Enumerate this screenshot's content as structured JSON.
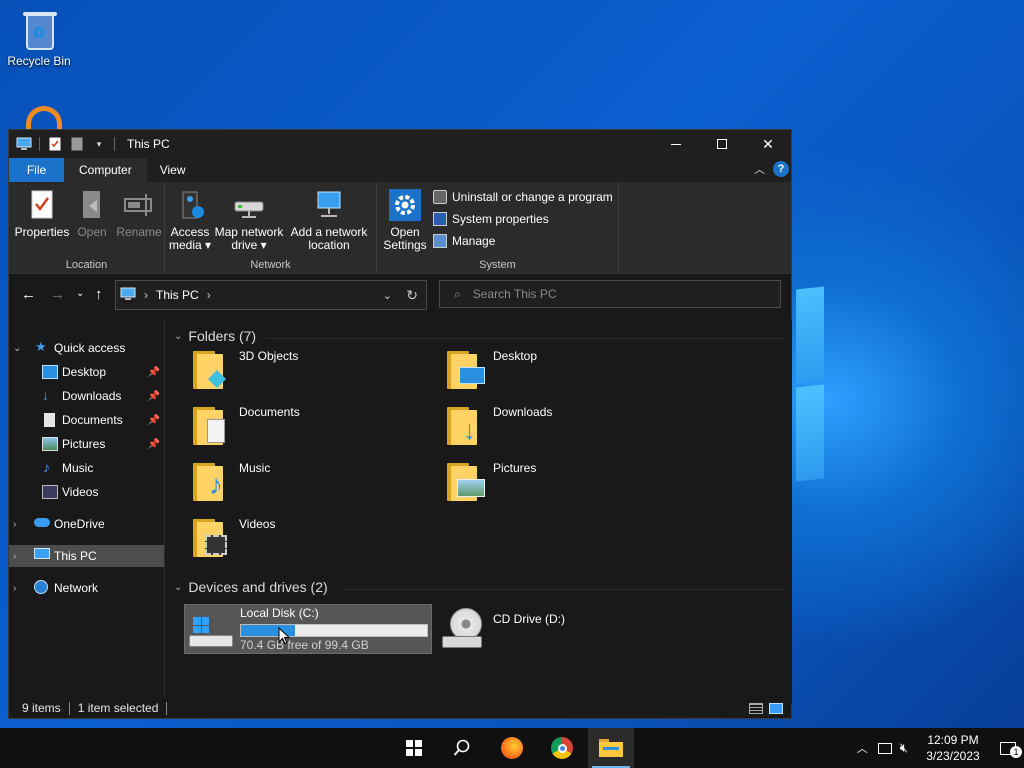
{
  "desktop": {
    "recycle_bin_label": "Recycle Bin"
  },
  "window": {
    "title": "This PC",
    "controls": {
      "minimize": "—",
      "maximize": "☐",
      "close": "✕"
    }
  },
  "ribbon_tabs": {
    "file": "File",
    "computer": "Computer",
    "view": "View",
    "help": "?"
  },
  "ribbon": {
    "location": {
      "label": "Location",
      "properties": "Properties",
      "open": "Open",
      "rename": "Rename"
    },
    "network": {
      "label": "Network",
      "access_media_l1": "Access",
      "access_media_l2": "media ▾",
      "map_drive_l1": "Map network",
      "map_drive_l2": "drive ▾",
      "add_location_l1": "Add a network",
      "add_location_l2": "location"
    },
    "system": {
      "label": "System",
      "open_settings_l1": "Open",
      "open_settings_l2": "Settings",
      "uninstall": "Uninstall or change a program",
      "system_properties": "System properties",
      "manage": "Manage"
    }
  },
  "address": {
    "path_root": "This PC",
    "sep": "›",
    "search_placeholder": "Search This PC"
  },
  "nav": {
    "quick_access": "Quick access",
    "desktop": "Desktop",
    "downloads": "Downloads",
    "documents": "Documents",
    "pictures": "Pictures",
    "music": "Music",
    "videos": "Videos",
    "onedrive": "OneDrive",
    "this_pc": "This PC",
    "network": "Network"
  },
  "content": {
    "folders_header": "Folders (7)",
    "folders": [
      "3D Objects",
      "Desktop",
      "Documents",
      "Downloads",
      "Music",
      "Pictures",
      "Videos"
    ],
    "devices_header": "Devices and drives (2)",
    "local_disk": {
      "name": "Local Disk (C:)",
      "free_text": "70.4 GB free of 99.4 GB",
      "used_fraction": 0.29
    },
    "cd_drive": {
      "name": "CD Drive (D:)"
    }
  },
  "status": {
    "items": "9 items",
    "selected": "1 item selected"
  },
  "taskbar": {
    "time": "12:09 PM",
    "date": "3/23/2023",
    "notification_count": "1",
    "icons": [
      "start-icon",
      "search-icon",
      "firefox-icon",
      "chrome-icon",
      "file-explorer-icon"
    ]
  },
  "colors": {
    "accent": "#1a73c8",
    "window_bg": "#191919",
    "ribbon_bg": "#2b2b2b",
    "selection": "#4d4d4d",
    "folder_yellow": "#ffd265"
  }
}
